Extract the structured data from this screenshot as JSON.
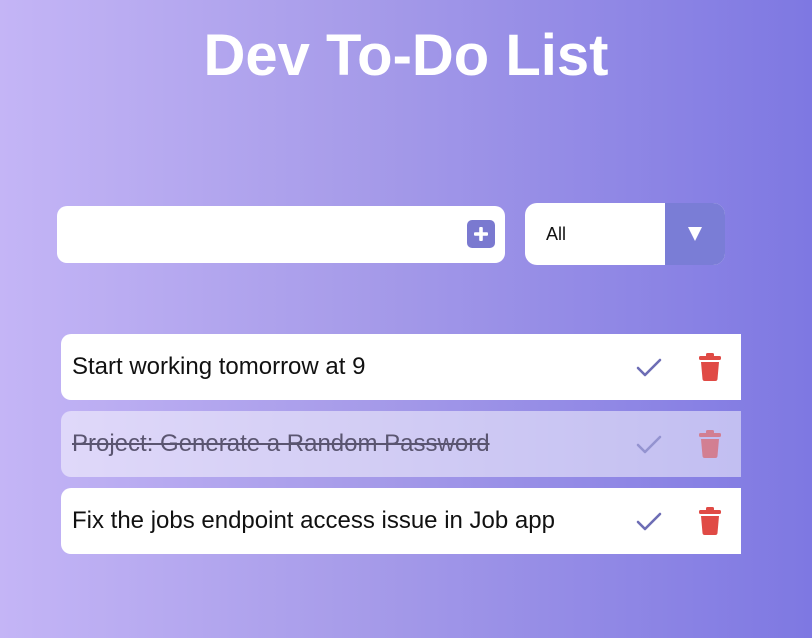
{
  "app": {
    "title": "Dev To-Do List"
  },
  "form": {
    "input_value": "",
    "input_placeholder": "",
    "add_icon": "plus-square-icon"
  },
  "filter": {
    "selected": "All",
    "arrow_icon": "caret-down-icon"
  },
  "todos": [
    {
      "text": "Start working tomorrow at 9",
      "completed": false
    },
    {
      "text": "Project: Generate a Random Password",
      "completed": true
    },
    {
      "text": "Fix the jobs endpoint access issue in Job app",
      "completed": false
    }
  ],
  "icons": {
    "complete": "check-icon",
    "delete": "trash-icon"
  },
  "colors": {
    "background_start": "#c4b5f6",
    "background_end": "#7e78e2",
    "accent": "#7a79d0",
    "check": "#6d6db5",
    "trash": "#e04a45",
    "title": "#ffffff"
  }
}
